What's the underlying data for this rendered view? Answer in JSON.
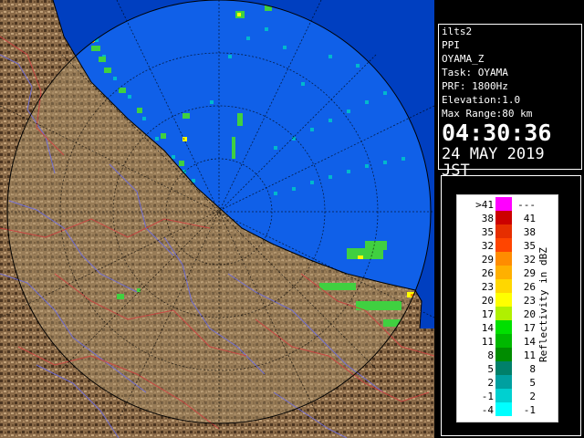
{
  "info": {
    "site": "ilts2",
    "product": "PPI",
    "field": "OYAMA_Z",
    "task": "Task: OYAMA",
    "prf": "PRF: 1800Hz",
    "elevation": "Elevation:1.0",
    "max_range": "Max Range:80 km",
    "time": "04:30:36",
    "date": "24 MAY 2019 JST"
  },
  "legend": {
    "unit_label": "Reflectivity in dBZ",
    "rows": [
      {
        "lo": ">41",
        "hi": "---",
        "color": "#ff00ff"
      },
      {
        "lo": "38",
        "hi": "41",
        "color": "#cc0000"
      },
      {
        "lo": "35",
        "hi": "38",
        "color": "#e62e00"
      },
      {
        "lo": "32",
        "hi": "35",
        "color": "#ff4500"
      },
      {
        "lo": "29",
        "hi": "32",
        "color": "#ff8c00"
      },
      {
        "lo": "26",
        "hi": "29",
        "color": "#ffb000"
      },
      {
        "lo": "23",
        "hi": "26",
        "color": "#ffd700"
      },
      {
        "lo": "20",
        "hi": "23",
        "color": "#ffff00"
      },
      {
        "lo": "17",
        "hi": "20",
        "color": "#b0f000"
      },
      {
        "lo": "14",
        "hi": "17",
        "color": "#00e000"
      },
      {
        "lo": "11",
        "hi": "14",
        "color": "#00b800"
      },
      {
        "lo": "8",
        "hi": "11",
        "color": "#008c00"
      },
      {
        "lo": "5",
        "hi": "8",
        "color": "#00806a"
      },
      {
        "lo": "2",
        "hi": "5",
        "color": "#00a0a0"
      },
      {
        "lo": "-1",
        "hi": "2",
        "color": "#00d0d0"
      },
      {
        "lo": "-4",
        "hi": "-1",
        "color": "#00ffff"
      }
    ]
  },
  "colors": {
    "sea": "#1060e8",
    "outside_range": "#003fc0",
    "land": "#8a6a48",
    "rivers": "#6e6ee0",
    "boundaries": "#d04040"
  }
}
